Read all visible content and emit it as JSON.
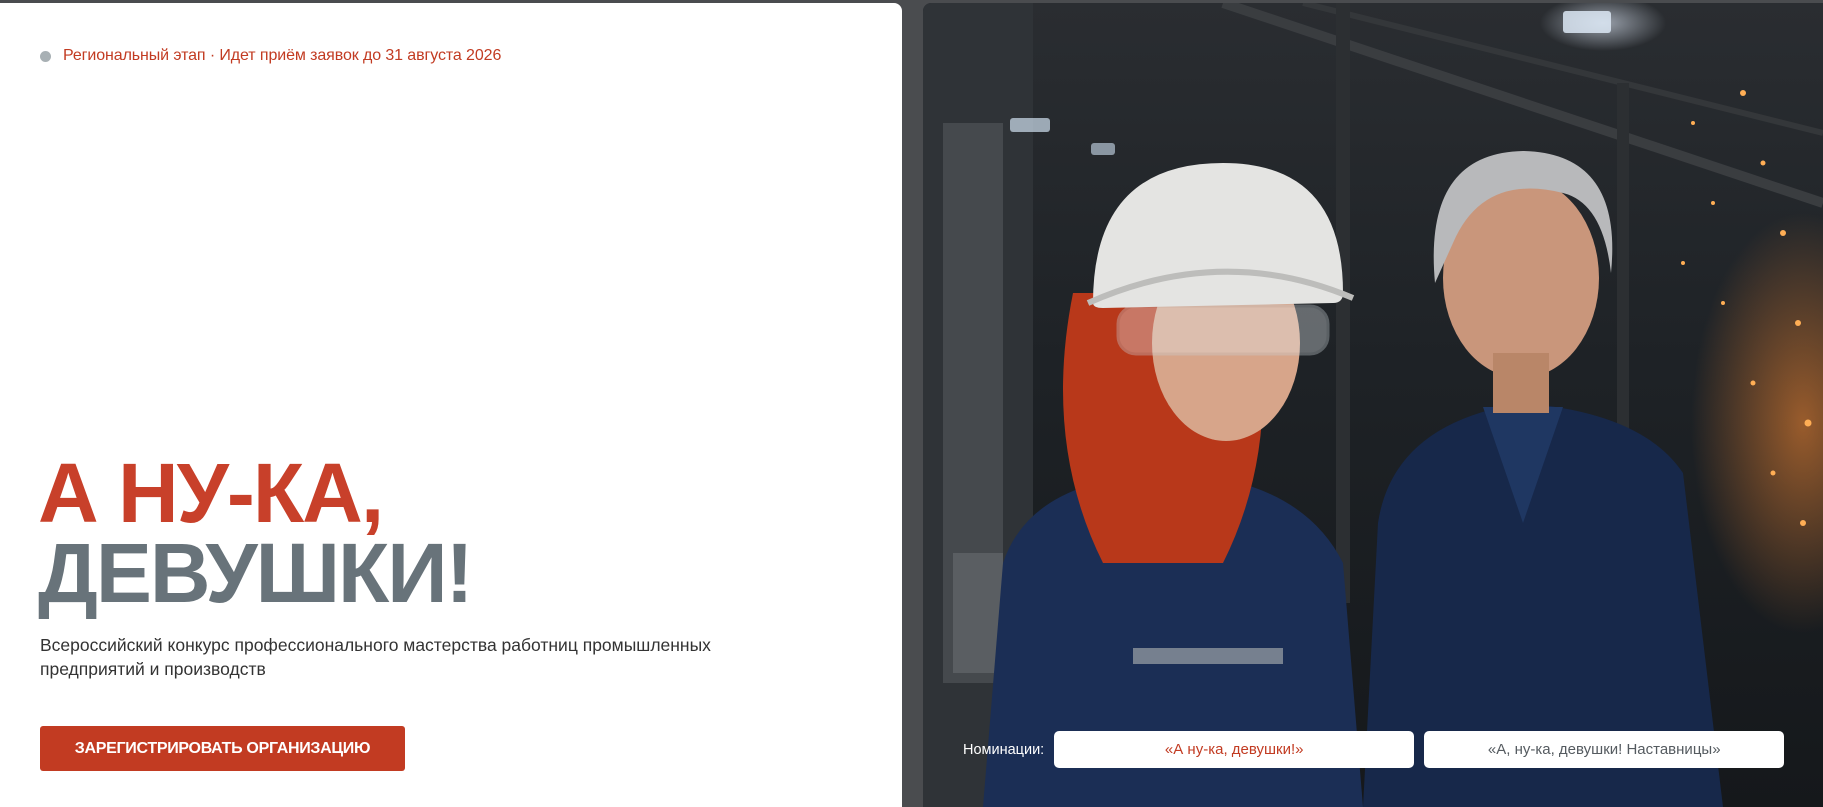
{
  "header": {
    "status_text": "Региональный этап · Идет приём заявок до 31 августа 2026"
  },
  "hero": {
    "title_line1": "А НУ-КА,",
    "title_line2": "ДЕВУШКИ!",
    "subtitle": "Всероссийский конкурс профессионального мастерства работниц промышленных предприятий и производств",
    "cta_label": "ЗАРЕГИСТРИРОВАТЬ ОРГАНИЗАЦИЮ"
  },
  "nominations": {
    "label": "Номинации:",
    "items": [
      {
        "label": "«А ну-ка, девушки!»",
        "active": true
      },
      {
        "label": "«А, ну-ка, девушки! Наставницы»",
        "active": false
      }
    ]
  },
  "colors": {
    "accent": "#c23b22",
    "title_gray": "#68737a",
    "status_dot": "#a8b0b4"
  }
}
